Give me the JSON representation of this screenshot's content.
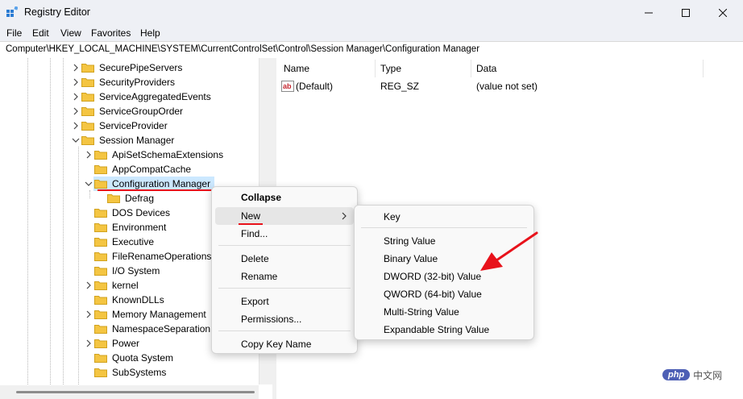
{
  "window": {
    "title": "Registry Editor",
    "controls": {
      "minimize": "minimize",
      "maximize": "maximize",
      "close": "close"
    }
  },
  "menubar": [
    "File",
    "Edit",
    "View",
    "Favorites",
    "Help"
  ],
  "address": "Computer\\HKEY_LOCAL_MACHINE\\SYSTEM\\CurrentControlSet\\Control\\Session Manager\\Configuration Manager",
  "tree": {
    "items": [
      {
        "label": "SecurePipeServers",
        "expander": "collapsed",
        "selected": false
      },
      {
        "label": "SecurityProviders",
        "expander": "collapsed",
        "selected": false
      },
      {
        "label": "ServiceAggregatedEvents",
        "expander": "collapsed",
        "selected": false
      },
      {
        "label": "ServiceGroupOrder",
        "expander": "collapsed",
        "selected": false
      },
      {
        "label": "ServiceProvider",
        "expander": "collapsed",
        "selected": false
      },
      {
        "label": "Session Manager",
        "expander": "expanded",
        "selected": false
      },
      {
        "label": "ApiSetSchemaExtensions",
        "expander": "collapsed",
        "selected": false
      },
      {
        "label": "AppCompatCache",
        "expander": "none",
        "selected": false
      },
      {
        "label": "Configuration Manager",
        "expander": "expanded",
        "selected": true
      },
      {
        "label": "Defrag",
        "expander": "none",
        "selected": false
      },
      {
        "label": "DOS Devices",
        "expander": "none",
        "selected": false
      },
      {
        "label": "Environment",
        "expander": "none",
        "selected": false
      },
      {
        "label": "Executive",
        "expander": "none",
        "selected": false
      },
      {
        "label": "FileRenameOperations",
        "expander": "none",
        "selected": false
      },
      {
        "label": "I/O System",
        "expander": "none",
        "selected": false
      },
      {
        "label": "kernel",
        "expander": "collapsed",
        "selected": false
      },
      {
        "label": "KnownDLLs",
        "expander": "none",
        "selected": false
      },
      {
        "label": "Memory Management",
        "expander": "collapsed",
        "selected": false
      },
      {
        "label": "NamespaceSeparation",
        "expander": "none",
        "selected": false
      },
      {
        "label": "Power",
        "expander": "collapsed",
        "selected": false
      },
      {
        "label": "Quota System",
        "expander": "none",
        "selected": false
      },
      {
        "label": "SubSystems",
        "expander": "none",
        "selected": false
      }
    ]
  },
  "list": {
    "columns": [
      "Name",
      "Type",
      "Data"
    ],
    "rows": [
      {
        "icon": "string-value-icon",
        "name": "(Default)",
        "type": "REG_SZ",
        "data": "(value not set)"
      }
    ]
  },
  "context_menu": {
    "items": [
      "Collapse",
      "New",
      "Find...",
      "Delete",
      "Rename",
      "Export",
      "Permissions...",
      "Copy Key Name"
    ]
  },
  "submenu": {
    "items": [
      "Key",
      "String Value",
      "Binary Value",
      "DWORD (32-bit) Value",
      "QWORD (64-bit) Value",
      "Multi-String Value",
      "Expandable String Value"
    ]
  },
  "watermark": {
    "badge": "php",
    "text": "中文网"
  },
  "colors": {
    "selection": "#cce8ff",
    "annotation_red": "#e8121b",
    "folder": "#f4c542",
    "chrome": "#eef0f5"
  }
}
